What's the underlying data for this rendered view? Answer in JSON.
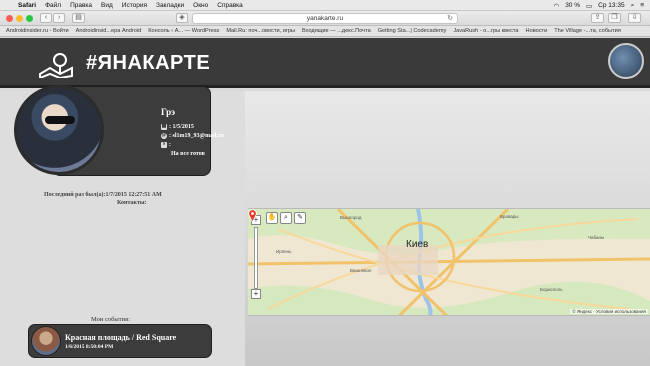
{
  "menubar": {
    "app": "Safari",
    "items": [
      "Файл",
      "Правка",
      "Вид",
      "История",
      "Закладки",
      "Окно",
      "Справка"
    ],
    "battery": "30 %",
    "clock": "Ср 13:35"
  },
  "browser": {
    "url": "yanakarte.ru"
  },
  "bookmarks": [
    "Androidinsider.ru - Войти",
    "Androidinsid...ера Android",
    "Консоль ‹ A... — WordPress",
    "Mail.Ru: поч...овости, игры",
    "Входящие — ...декс.Почта",
    "Getting Sta...| Codecademy",
    "JavaRush - о...гры квеста",
    "Новости",
    "The Village -...та, события"
  ],
  "site": {
    "logo_text": "#ЯНАКАРТЕ"
  },
  "profile": {
    "name": "Грэ",
    "birthday": ": 1/5/2015",
    "email": ": sl1m19_93@mail.ru",
    "skype": ":",
    "status": "На все готов",
    "last_seen": "Последний раз был(а):1/7/2015 12:27:51 AM",
    "contacts_label": "Контакты:"
  },
  "events": {
    "label": "Мои события:",
    "items": [
      {
        "title": "Красная площадь / Red Square",
        "date": "1/6/2015 8:50:04 PM"
      }
    ]
  },
  "map": {
    "city": "Киев",
    "copyright": "© Яндекс · Условия использования",
    "labels": [
      "Вышгород",
      "Бровары",
      "Ирпень",
      "Вишневое",
      "Борисполь",
      "Чабаны"
    ]
  },
  "colors": {
    "header_bg": "#3a3a3a",
    "card_bg": "#3c3c3c",
    "panel_bg": "#dddddd"
  }
}
